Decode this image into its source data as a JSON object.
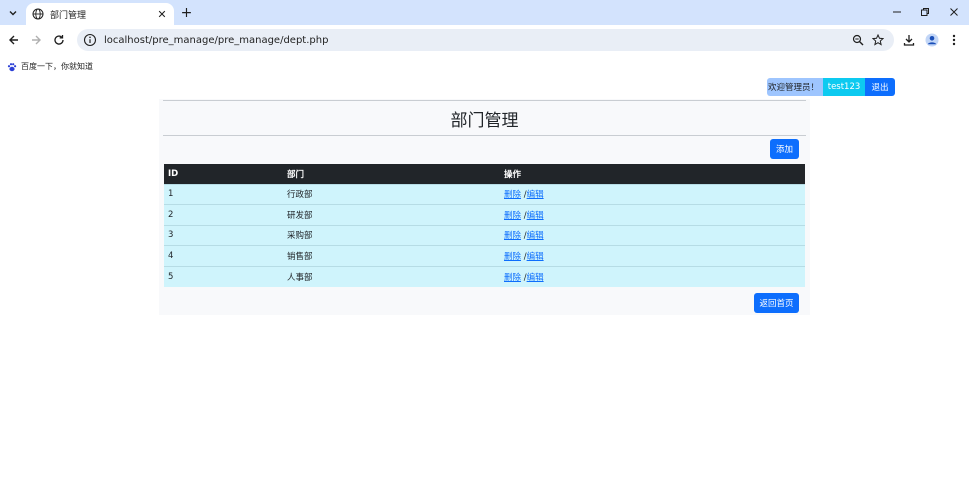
{
  "browser": {
    "tab": {
      "title": "部门管理"
    },
    "url": "localhost/pre_manage/pre_manage/dept.php",
    "bookmarks": [
      {
        "label": "百度一下，你就知道"
      }
    ]
  },
  "header": {
    "welcome": "欢迎管理员！",
    "username": "test123",
    "logout": "退出"
  },
  "page": {
    "title": "部门管理",
    "add_label": "添加",
    "home_label": "返回首页"
  },
  "table": {
    "columns": [
      "ID",
      "部门",
      "操作"
    ],
    "rows": [
      {
        "id": "1",
        "name": "行政部",
        "delete": "删除",
        "sep": " /",
        "edit": "编辑"
      },
      {
        "id": "2",
        "name": "研发部",
        "delete": "删除",
        "sep": " /",
        "edit": "编辑"
      },
      {
        "id": "3",
        "name": "采购部",
        "delete": "删除",
        "sep": " /",
        "edit": "编辑"
      },
      {
        "id": "4",
        "name": "销售部",
        "delete": "删除",
        "sep": " /",
        "edit": "编辑"
      },
      {
        "id": "5",
        "name": "人事部",
        "delete": "删除",
        "sep": " /",
        "edit": "编辑"
      }
    ]
  },
  "colors": {
    "primary": "#0d6efd",
    "info": "#0dcaf0",
    "row_bg": "#cff4fc",
    "header_bg": "#212529"
  },
  "icons": {
    "tab_menu": "chevron-down-icon",
    "favicon": "globe-icon",
    "tab_close": "close-icon",
    "new_tab": "plus-icon",
    "back": "arrow-left-icon",
    "forward": "arrow-right-icon",
    "reload": "reload-icon",
    "site_info": "info-icon",
    "zoom": "zoom-icon",
    "bookmark_star": "star-icon",
    "download": "download-icon",
    "profile": "profile-icon",
    "menu": "kebab-menu-icon",
    "baidu": "baidu-paw-icon"
  }
}
